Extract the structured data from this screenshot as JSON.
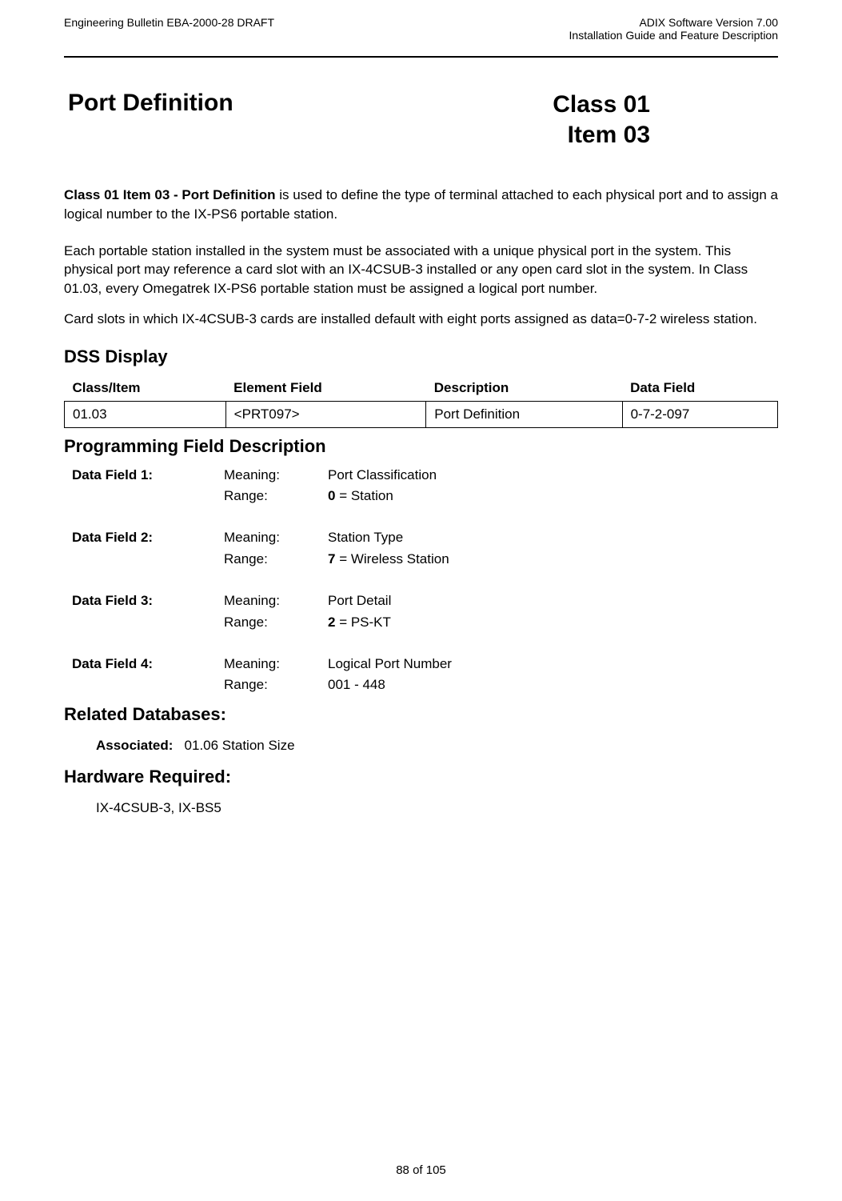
{
  "header": {
    "left": "Engineering Bulletin EBA-2000-28 DRAFT",
    "right_line1": "ADIX Software Version 7.00",
    "right_line2": "Installation Guide and Feature Description"
  },
  "title": {
    "left": "Port Definition",
    "right_line1": "Class 01",
    "right_line2": "Item 03"
  },
  "intro": {
    "bold_lead": "Class 01 Item 03 - Port Definition",
    "rest": " is used to define the type of terminal attached to each physical port and to assign a logical number to the IX-PS6 portable station."
  },
  "para2": "Each portable station installed in the system must be associated with a unique physical port in the system.  This physical port may reference a card slot with an IX-4CSUB-3 installed or any open card slot in the system.  In Class 01.03, every Omegatrek IX-PS6 portable station must be assigned a logical port number.",
  "para3": "Card slots in which IX-4CSUB-3 cards are installed  default with eight ports assigned as data=0-7-2 wireless station.",
  "dss": {
    "heading": "DSS Display",
    "headers": [
      "Class/Item",
      "Element Field",
      "Description",
      "Data Field"
    ],
    "row": [
      "01.03",
      "<PRT097>",
      "Port Definition",
      "0-7-2-097"
    ]
  },
  "pfd": {
    "heading": "Programming Field Description",
    "fields": [
      {
        "label": "Data Field 1:",
        "meaning_key": "Meaning:",
        "meaning_val": "Port Classification",
        "range_key": "Range:",
        "range_bold": "0",
        "range_rest": " = Station"
      },
      {
        "label": "Data Field 2:",
        "meaning_key": "Meaning:",
        "meaning_val": "Station Type",
        "range_key": "Range:",
        "range_bold": "7",
        "range_rest": " = Wireless Station"
      },
      {
        "label": "Data Field 3:",
        "meaning_key": "Meaning:",
        "meaning_val": "Port Detail",
        "range_key": "Range:",
        "range_bold": "2",
        "range_rest": " = PS-KT"
      },
      {
        "label": "Data Field 4:",
        "meaning_key": "Meaning:",
        "meaning_val": "Logical Port Number",
        "range_key": "Range:",
        "range_bold": "",
        "range_rest": "001 - 448"
      }
    ]
  },
  "related": {
    "heading": "Related Databases:",
    "assoc_label": "Associated:",
    "assoc_val": "01.06 Station Size"
  },
  "hardware": {
    "heading": "Hardware Required:",
    "value": "IX-4CSUB-3, IX-BS5"
  },
  "footer": {
    "page": "88 of 105"
  }
}
